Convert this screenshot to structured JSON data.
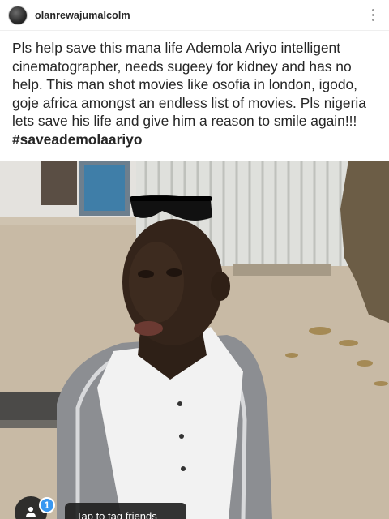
{
  "post": {
    "username": "olanrewajumalcolm",
    "caption": "Pls help save this mana life Ademola Ariyo intelligent cinematographer, needs sugeey for kidney and has no help. This man shot movies like osofia in london, igodo, goje africa amongst an endless list of movies. Pls nigeria lets save his life and give him a reason to smile again!!! ",
    "hashtag": "#saveademolaariyo"
  },
  "photo_overlay": {
    "tag_count": "1",
    "tag_tooltip": "Tap to tag friends"
  },
  "icons": {
    "more": "more-options-icon",
    "tag": "person-tag-icon"
  },
  "colors": {
    "badge_blue": "#3897f0",
    "text": "#262626"
  }
}
